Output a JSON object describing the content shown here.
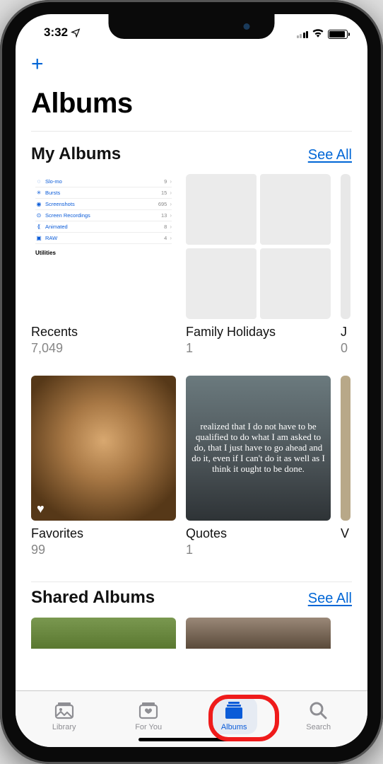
{
  "status": {
    "time": "3:32",
    "loc_icon": "✈"
  },
  "nav": {
    "plus": "+"
  },
  "title": "Albums",
  "sections": {
    "my_albums": {
      "title": "My Albums",
      "link": "See All"
    },
    "shared": {
      "title": "Shared Albums",
      "link": "See All"
    }
  },
  "recents_inner": {
    "rows": [
      {
        "icon": "◌",
        "label": "Slo-mo",
        "count": "9"
      },
      {
        "icon": "✳",
        "label": "Bursts",
        "count": "15"
      },
      {
        "icon": "◉",
        "label": "Screenshots",
        "count": "695"
      },
      {
        "icon": "⊙",
        "label": "Screen Recordings",
        "count": "13"
      },
      {
        "icon": "⟪",
        "label": "Animated",
        "count": "8"
      },
      {
        "icon": "▣",
        "label": "RAW",
        "count": "4"
      }
    ],
    "util": "Utilities"
  },
  "albums_row1": [
    {
      "name": "Recents",
      "count": "7,049"
    },
    {
      "name": "Family Holidays",
      "count": "1"
    },
    {
      "name": "J",
      "count": "0"
    }
  ],
  "albums_row2": [
    {
      "name": "Favorites",
      "count": "99"
    },
    {
      "name": "Quotes",
      "count": "1"
    },
    {
      "name": "V",
      "count": ""
    }
  ],
  "quote_text": "realized that I do not have to be qualified to do what I am asked to do, that I just have to go ahead and do it, even if I can't do it as well as I think it ought to be done.",
  "tabs": [
    {
      "label": "Library"
    },
    {
      "label": "For You"
    },
    {
      "label": "Albums"
    },
    {
      "label": "Search"
    }
  ]
}
